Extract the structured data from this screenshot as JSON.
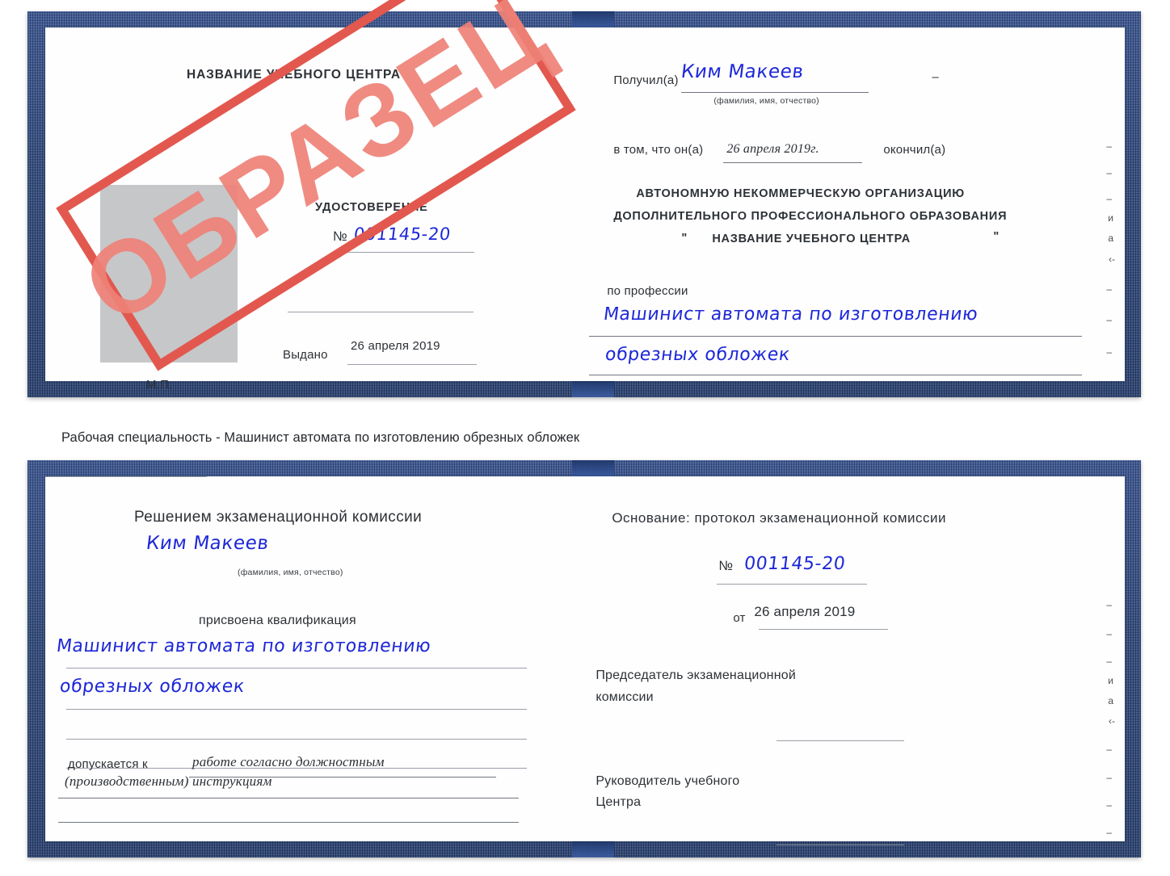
{
  "caption": "Рабочая специальность - Машинист автомата по изготовлению обрезных обложек",
  "colors": {
    "cover_blue": "#2b4a8a",
    "stamp_red": "#e2584f",
    "stamp_text_red": "#ef8278",
    "handwriting_blue": "#1d27d8",
    "photo_gray": "#c6c7c9"
  },
  "stamp": {
    "label": "ОБРАЗЕЦ"
  },
  "certificate_top": {
    "left_page": {
      "org_title": "НАЗВАНИЕ УЧЕБНОГО ЦЕНТРА",
      "doc_type": "УДОСТОВЕРЕНИЕ",
      "number_label": "№",
      "number_value": "001145-20",
      "issued_label": "Выдано",
      "issued_value": "26 апреля 2019",
      "seal_label": "М.П."
    },
    "right_page": {
      "received_label": "Получил(а)",
      "received_value": "Ким Макеев",
      "fio_hint": "(фамилия, имя, отчество)",
      "in_that_label": "в том, что он(а)",
      "completion_date": "26 апреля 2019г.",
      "finished_label": "окончил(а)",
      "org_line1": "АВТОНОМНУЮ НЕКОММЕРЧЕСКУЮ ОРГАНИЗАЦИЮ",
      "org_line2": "ДОПОЛНИТЕЛЬНОГО ПРОФЕССИОНАЛЬНОГО ОБРАЗОВАНИЯ",
      "org_quote_open": "\"",
      "org_line3": "НАЗВАНИЕ УЧЕБНОГО ЦЕНТРА",
      "org_quote_close": "\"",
      "profession_label": "по профессии",
      "profession_line1": "Машинист автомата по изготовлению",
      "profession_line2": "обрезных обложек"
    },
    "edge_fragments": [
      "–",
      "–",
      "–",
      "и",
      "а",
      "‹-",
      "–",
      "–",
      "–"
    ]
  },
  "certificate_bottom": {
    "left_page": {
      "decision_title": "Решением экзаменационной комиссии",
      "name_value": "Ким Макеев",
      "fio_hint": "(фамилия, имя, отчество)",
      "qualification_label": "присвоена квалификация",
      "qualification_line1": "Машинист автомата по изготовлению",
      "qualification_line2": "обрезных обложек",
      "admitted_label": "допускается к",
      "admitted_value_line1": "работе согласно должностным",
      "admitted_value_line2": "(производственным) инструкциям"
    },
    "right_page": {
      "basis_label": "Основание: протокол экзаменационной комиссии",
      "number_label": "№",
      "number_value": "001145-20",
      "date_label": "от",
      "date_value": "26 апреля 2019",
      "chairman_line1": "Председатель экзаменационной",
      "chairman_line2": "комиссии",
      "director_line1": "Руководитель учебного",
      "director_line2": "Центра"
    },
    "edge_fragments": [
      "–",
      "–",
      "–",
      "и",
      "а",
      "‹-",
      "–",
      "–",
      "–",
      "–"
    ]
  }
}
